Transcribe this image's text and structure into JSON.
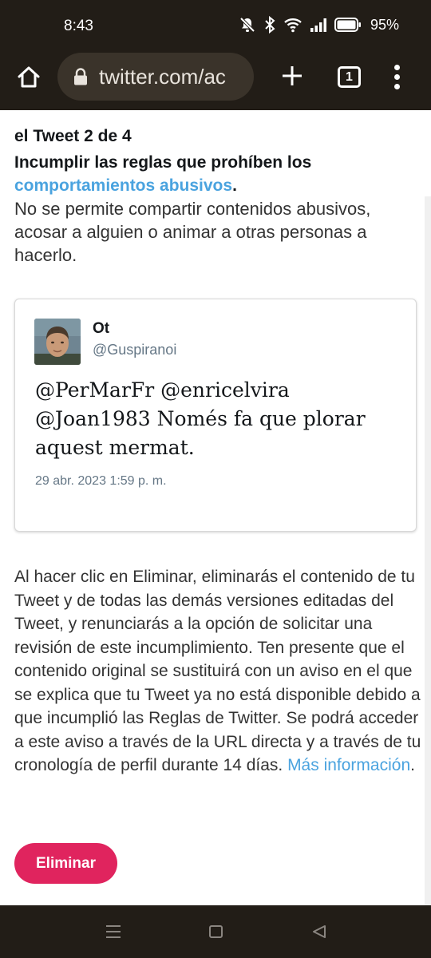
{
  "status_bar": {
    "time": "8:43",
    "battery_percent": "95%"
  },
  "browser": {
    "url": "twitter.com/ac",
    "tab_count": "1",
    "icons": [
      "home-icon",
      "lock-icon",
      "plus-icon",
      "tab-switcher-icon",
      "overflow-menu-icon"
    ]
  },
  "page": {
    "tweet_counter": "el Tweet 2 de 4",
    "rule_heading_prefix": "Incumplir las reglas que prohíben los ",
    "rule_heading_link": "comportamientos abusivos",
    "rule_heading_suffix": ".",
    "rule_description": "No se permite compartir contenidos abusivos, acosar a alguien o animar a otras personas a hacerlo.",
    "tweet": {
      "author_name": "Ot",
      "author_handle": "@Guspiranoi",
      "text": "@PerMarFr @enricelvira @Joan1983 Només fa que plorar aquest mermat.",
      "date": "29 abr. 2023 1:59 p. m."
    },
    "notice_text": "Al hacer clic en Eliminar, eliminarás el contenido de tu Tweet y de todas las demás versiones editadas del Tweet, y renunciarás a la opción de solicitar una revisión de este incumplimiento. Ten presente que el contenido original se sustituirá con un aviso en el que se explica que tu Tweet ya no está disponible debido a que incumplió las Reglas de Twitter. Se podrá acceder a este aviso a través de la URL directa y a través de tu cronología de perfil durante 14 días. ",
    "more_info_link": "Más información",
    "notice_end": ".",
    "delete_button": "Eliminar"
  },
  "colors": {
    "link": "#4aa3df",
    "delete_button": "#e0245e",
    "chrome_bar": "#221d17"
  }
}
